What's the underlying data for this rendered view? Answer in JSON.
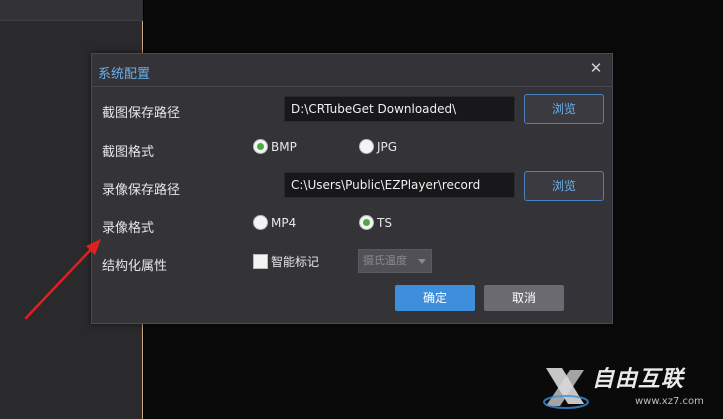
{
  "dialog": {
    "title": "系统配置",
    "close_symbol": "✕"
  },
  "screenshot_path": {
    "label": "截图保存路径",
    "value": "D:\\CRTubeGet Downloaded\\",
    "browse_label": "浏览"
  },
  "screenshot_format": {
    "label": "截图格式",
    "options": [
      "BMP",
      "JPG"
    ],
    "selected": "BMP"
  },
  "video_path": {
    "label": "录像保存路径",
    "value": "C:\\Users\\Public\\EZPlayer\\record",
    "browse_label": "浏览"
  },
  "video_format": {
    "label": "录像格式",
    "options": [
      "MP4",
      "TS"
    ],
    "selected": "TS"
  },
  "structured": {
    "label": "结构化属性",
    "checkbox_label": "智能标记",
    "checked": false,
    "select_value": "摄氏温度"
  },
  "buttons": {
    "ok": "确定",
    "cancel": "取消"
  },
  "watermark": {
    "text": "自由互联",
    "url": "www.xz7.com"
  },
  "colors": {
    "accent": "#3d8fdc",
    "title_blue": "#6ab0ea",
    "radio_checked": "#4caa3e",
    "arrow_red": "#e02020"
  }
}
